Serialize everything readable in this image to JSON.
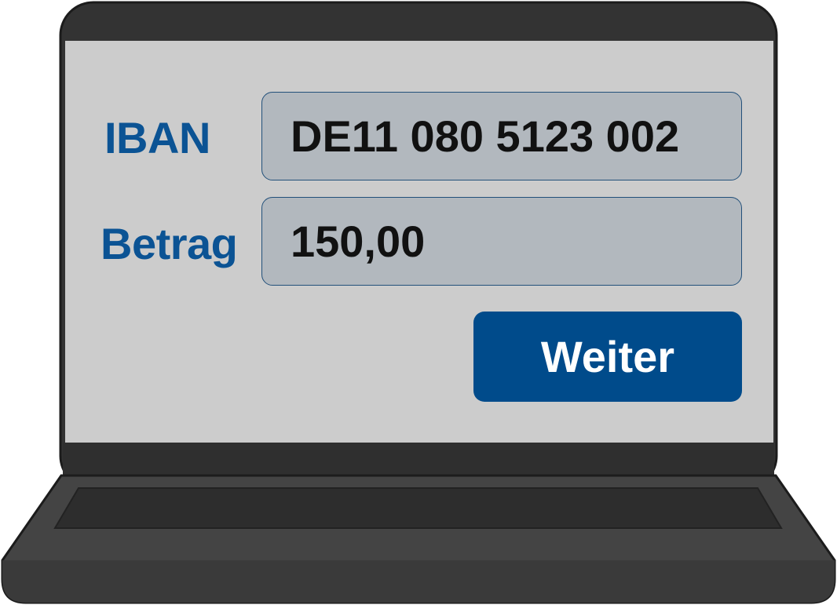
{
  "form": {
    "iban": {
      "label": "IBAN",
      "value": "DE11 080 5123 002"
    },
    "amount": {
      "label": "Betrag",
      "value": "150,00"
    },
    "next_button_label": "Weiter"
  },
  "colors": {
    "label_color": "#0b5394",
    "button_color": "#004b8b",
    "field_background": "#b2b8be",
    "screen_background": "#cccccc",
    "laptop_body": "#3b3b3b",
    "laptop_bezel": "#333333"
  }
}
